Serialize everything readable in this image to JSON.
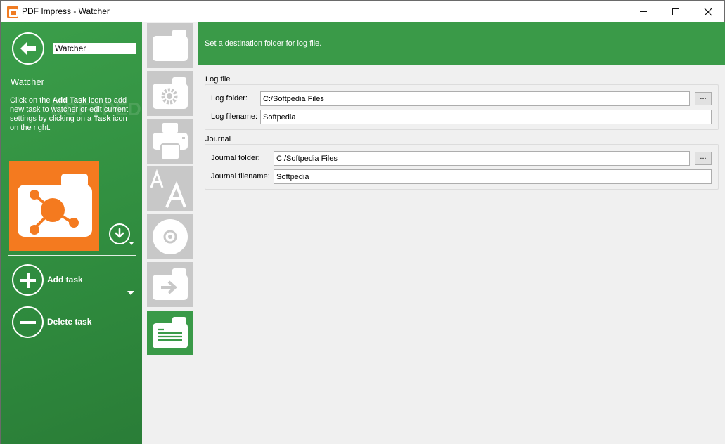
{
  "window": {
    "title": "PDF Impress - Watcher",
    "minimize_icon": "minimize-icon",
    "maximize_icon": "maximize-icon",
    "close_icon": "close-icon"
  },
  "sidebar": {
    "back_icon": "arrow-left-icon",
    "name_value": "Watcher",
    "title": "Watcher",
    "desc": {
      "p1": "Click on the ",
      "b1": "Add Task",
      "p2": " icon to add new task to watcher or edit current settings by clicking on a ",
      "b2": "Task",
      "p3": " icon on the right."
    },
    "watermark": "SOFTPEDIA",
    "add_task_label": "Add task",
    "delete_task_label": "Delete task",
    "accent_color": "#f47a1f",
    "panel_color": "#339444"
  },
  "tabs": [
    {
      "name": "folder-icon",
      "active": false
    },
    {
      "name": "settings-icon",
      "active": false
    },
    {
      "name": "printer-icon",
      "active": false
    },
    {
      "name": "font-icon",
      "active": false
    },
    {
      "name": "disc-icon",
      "active": false
    },
    {
      "name": "output-folder-icon",
      "active": false
    },
    {
      "name": "log-icon",
      "active": true
    }
  ],
  "banner": {
    "text": "Set a destination folder for log file."
  },
  "log": {
    "group_title": "Log file",
    "folder_label": "Log folder:",
    "folder_value": "C:/Softpedia Files",
    "browse_label": "...",
    "filename_label": "Log filename:",
    "filename_value": "Softpedia"
  },
  "journal": {
    "group_title": "Journal",
    "folder_label": "Journal folder:",
    "folder_value": "C:/Softpedia Files",
    "browse_label": "...",
    "filename_label": "Journal filename:",
    "filename_value": "Softpedia"
  }
}
